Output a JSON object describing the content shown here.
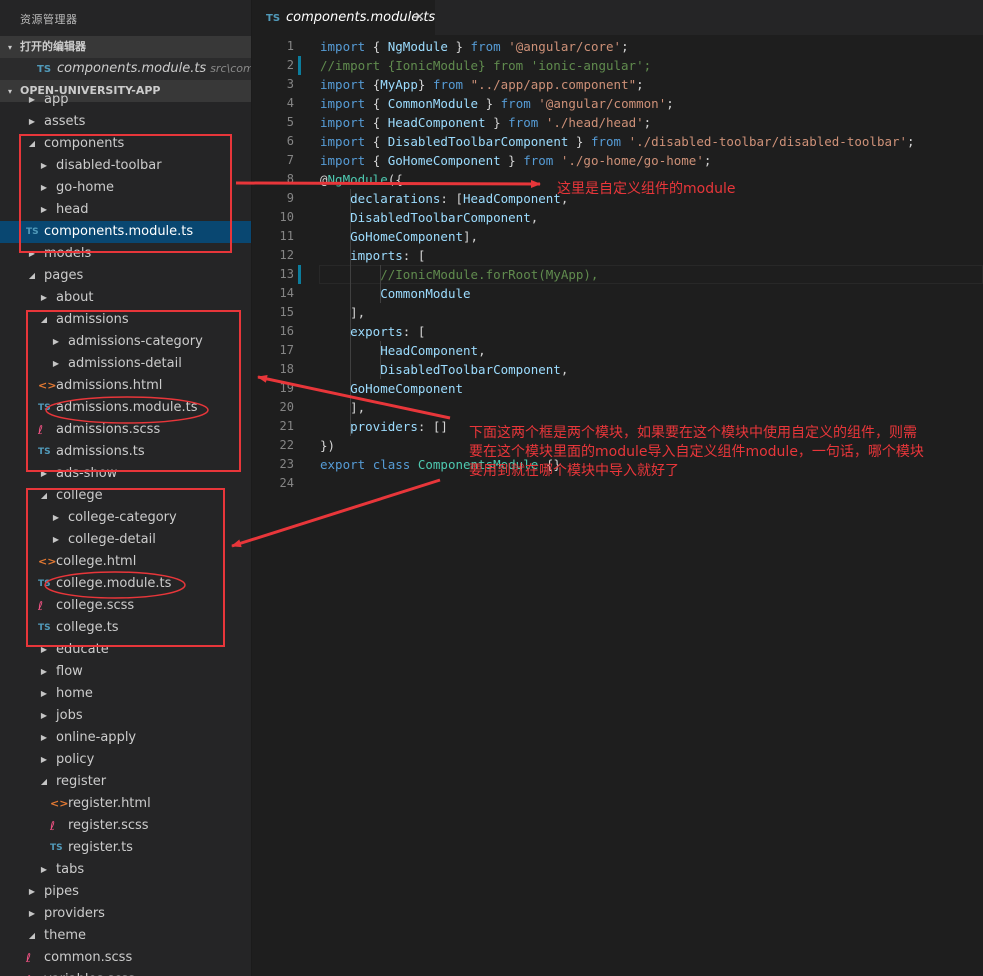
{
  "sidebar": {
    "title": "资源管理器",
    "open_editors_header": "打开的编辑器",
    "open_editor": {
      "icon": "TS",
      "name": "components.module.ts",
      "path": "src\\compo..."
    },
    "project_header": "OPEN-UNIVERSITY-APP",
    "tree": [
      {
        "label": "app",
        "depth": 0,
        "kind": "folder",
        "expanded": false
      },
      {
        "label": "assets",
        "depth": 0,
        "kind": "folder",
        "expanded": false
      },
      {
        "label": "components",
        "depth": 0,
        "kind": "folder",
        "expanded": true
      },
      {
        "label": "disabled-toolbar",
        "depth": 1,
        "kind": "folder",
        "expanded": false
      },
      {
        "label": "go-home",
        "depth": 1,
        "kind": "folder",
        "expanded": false
      },
      {
        "label": "head",
        "depth": 1,
        "kind": "folder",
        "expanded": false
      },
      {
        "label": "components.module.ts",
        "depth": 0,
        "kind": "ts",
        "selected": true
      },
      {
        "label": "models",
        "depth": 0,
        "kind": "folder",
        "expanded": false
      },
      {
        "label": "pages",
        "depth": 0,
        "kind": "folder",
        "expanded": true
      },
      {
        "label": "about",
        "depth": 1,
        "kind": "folder",
        "expanded": false
      },
      {
        "label": "admissions",
        "depth": 1,
        "kind": "folder",
        "expanded": true
      },
      {
        "label": "admissions-category",
        "depth": 2,
        "kind": "folder",
        "expanded": false
      },
      {
        "label": "admissions-detail",
        "depth": 2,
        "kind": "folder",
        "expanded": false
      },
      {
        "label": "admissions.html",
        "depth": 1,
        "kind": "html"
      },
      {
        "label": "admissions.module.ts",
        "depth": 1,
        "kind": "ts"
      },
      {
        "label": "admissions.scss",
        "depth": 1,
        "kind": "scss"
      },
      {
        "label": "admissions.ts",
        "depth": 1,
        "kind": "ts"
      },
      {
        "label": "ads-show",
        "depth": 1,
        "kind": "folder",
        "expanded": false
      },
      {
        "label": "college",
        "depth": 1,
        "kind": "folder",
        "expanded": true
      },
      {
        "label": "college-category",
        "depth": 2,
        "kind": "folder",
        "expanded": false
      },
      {
        "label": "college-detail",
        "depth": 2,
        "kind": "folder",
        "expanded": false
      },
      {
        "label": "college.html",
        "depth": 1,
        "kind": "html"
      },
      {
        "label": "college.module.ts",
        "depth": 1,
        "kind": "ts"
      },
      {
        "label": "college.scss",
        "depth": 1,
        "kind": "scss"
      },
      {
        "label": "college.ts",
        "depth": 1,
        "kind": "ts"
      },
      {
        "label": "educate",
        "depth": 1,
        "kind": "folder",
        "expanded": false
      },
      {
        "label": "flow",
        "depth": 1,
        "kind": "folder",
        "expanded": false
      },
      {
        "label": "home",
        "depth": 1,
        "kind": "folder",
        "expanded": false
      },
      {
        "label": "jobs",
        "depth": 1,
        "kind": "folder",
        "expanded": false
      },
      {
        "label": "online-apply",
        "depth": 1,
        "kind": "folder",
        "expanded": false
      },
      {
        "label": "policy",
        "depth": 1,
        "kind": "folder",
        "expanded": false
      },
      {
        "label": "register",
        "depth": 1,
        "kind": "folder",
        "expanded": true
      },
      {
        "label": "register.html",
        "depth": 2,
        "kind": "html"
      },
      {
        "label": "register.scss",
        "depth": 2,
        "kind": "scss"
      },
      {
        "label": "register.ts",
        "depth": 2,
        "kind": "ts"
      },
      {
        "label": "tabs",
        "depth": 1,
        "kind": "folder",
        "expanded": false
      },
      {
        "label": "pipes",
        "depth": 0,
        "kind": "folder",
        "expanded": false
      },
      {
        "label": "providers",
        "depth": 0,
        "kind": "folder",
        "expanded": false
      },
      {
        "label": "theme",
        "depth": 0,
        "kind": "folder",
        "expanded": true
      },
      {
        "label": "common.scss",
        "depth": 0,
        "kind": "scss"
      },
      {
        "label": "variables.scss",
        "depth": 0,
        "kind": "scss"
      }
    ]
  },
  "editor": {
    "tab": {
      "icon": "TS",
      "name": "components.module.ts",
      "close": "✕"
    },
    "lines": [
      [
        [
          "kw",
          "import "
        ],
        [
          "pl",
          "{ "
        ],
        [
          "id",
          "NgModule"
        ],
        [
          "pl",
          " } "
        ],
        [
          "kw",
          "from "
        ],
        [
          "str",
          "'@angular/core'"
        ],
        [
          "pl",
          ";"
        ]
      ],
      [
        [
          "cm",
          "//import {IonicModule} from 'ionic-angular';"
        ]
      ],
      [
        [
          "kw",
          "import "
        ],
        [
          "pl",
          "{"
        ],
        [
          "id",
          "MyApp"
        ],
        [
          "pl",
          "} "
        ],
        [
          "kw",
          "from "
        ],
        [
          "str",
          "\"../app/app.component\""
        ],
        [
          "pl",
          ";"
        ]
      ],
      [
        [
          "kw",
          "import "
        ],
        [
          "pl",
          "{ "
        ],
        [
          "id",
          "CommonModule"
        ],
        [
          "pl",
          " } "
        ],
        [
          "kw",
          "from "
        ],
        [
          "str",
          "'@angular/common'"
        ],
        [
          "pl",
          ";"
        ]
      ],
      [
        [
          "kw",
          "import "
        ],
        [
          "pl",
          "{ "
        ],
        [
          "id",
          "HeadComponent"
        ],
        [
          "pl",
          " } "
        ],
        [
          "kw",
          "from "
        ],
        [
          "str",
          "'./head/head'"
        ],
        [
          "pl",
          ";"
        ]
      ],
      [
        [
          "kw",
          "import "
        ],
        [
          "pl",
          "{ "
        ],
        [
          "id",
          "DisabledToolbarComponent"
        ],
        [
          "pl",
          " } "
        ],
        [
          "kw",
          "from "
        ],
        [
          "str",
          "'./disabled-toolbar/disabled-toolbar'"
        ],
        [
          "pl",
          ";"
        ]
      ],
      [
        [
          "kw",
          "import "
        ],
        [
          "pl",
          "{ "
        ],
        [
          "id",
          "GoHomeComponent"
        ],
        [
          "pl",
          " } "
        ],
        [
          "kw",
          "from "
        ],
        [
          "str",
          "'./go-home/go-home'"
        ],
        [
          "pl",
          ";"
        ]
      ],
      [
        [
          "pl",
          "@"
        ],
        [
          "ty",
          "NgModule"
        ],
        [
          "pl",
          "({"
        ]
      ],
      [
        [
          "pl",
          "    "
        ],
        [
          "id",
          "declarations"
        ],
        [
          "pl",
          ": ["
        ],
        [
          "id",
          "HeadComponent"
        ],
        [
          "pl",
          ","
        ]
      ],
      [
        [
          "pl",
          "    "
        ],
        [
          "id",
          "DisabledToolbarComponent"
        ],
        [
          "pl",
          ","
        ]
      ],
      [
        [
          "pl",
          "    "
        ],
        [
          "id",
          "GoHomeComponent"
        ],
        [
          "pl",
          "],"
        ]
      ],
      [
        [
          "pl",
          "    "
        ],
        [
          "id",
          "imports"
        ],
        [
          "pl",
          ": ["
        ]
      ],
      [
        [
          "pl",
          "        "
        ],
        [
          "cm",
          "//IonicModule.forRoot(MyApp),"
        ]
      ],
      [
        [
          "pl",
          "        "
        ],
        [
          "id",
          "CommonModule"
        ]
      ],
      [
        [
          "pl",
          "    ],"
        ]
      ],
      [
        [
          "pl",
          "    "
        ],
        [
          "id",
          "exports"
        ],
        [
          "pl",
          ": ["
        ]
      ],
      [
        [
          "pl",
          "        "
        ],
        [
          "id",
          "HeadComponent"
        ],
        [
          "pl",
          ","
        ]
      ],
      [
        [
          "pl",
          "        "
        ],
        [
          "id",
          "DisabledToolbarComponent"
        ],
        [
          "pl",
          ","
        ]
      ],
      [
        [
          "pl",
          "    "
        ],
        [
          "id",
          "GoHomeComponent"
        ]
      ],
      [
        [
          "pl",
          "    ],"
        ]
      ],
      [
        [
          "pl",
          "    "
        ],
        [
          "id",
          "providers"
        ],
        [
          "pl",
          ": []"
        ]
      ],
      [
        [
          "pl",
          "})"
        ]
      ],
      [
        [
          "kw",
          "export "
        ],
        [
          "kw",
          "class "
        ],
        [
          "ty",
          "ComponentsModule"
        ],
        [
          "pl",
          " {}"
        ]
      ],
      [
        [
          "pl",
          ""
        ]
      ]
    ]
  },
  "annotations": {
    "note1": "这里是自定义组件的module",
    "note2": [
      "下面这两个框是两个模块，如果要在这个模块中使用自定义的组件，则需",
      "要在这个模块里面的module导入自定义组件module，一句话，哪个模块",
      "要用到就在哪个模块中导入就好了"
    ],
    "color": "#e8363a"
  }
}
